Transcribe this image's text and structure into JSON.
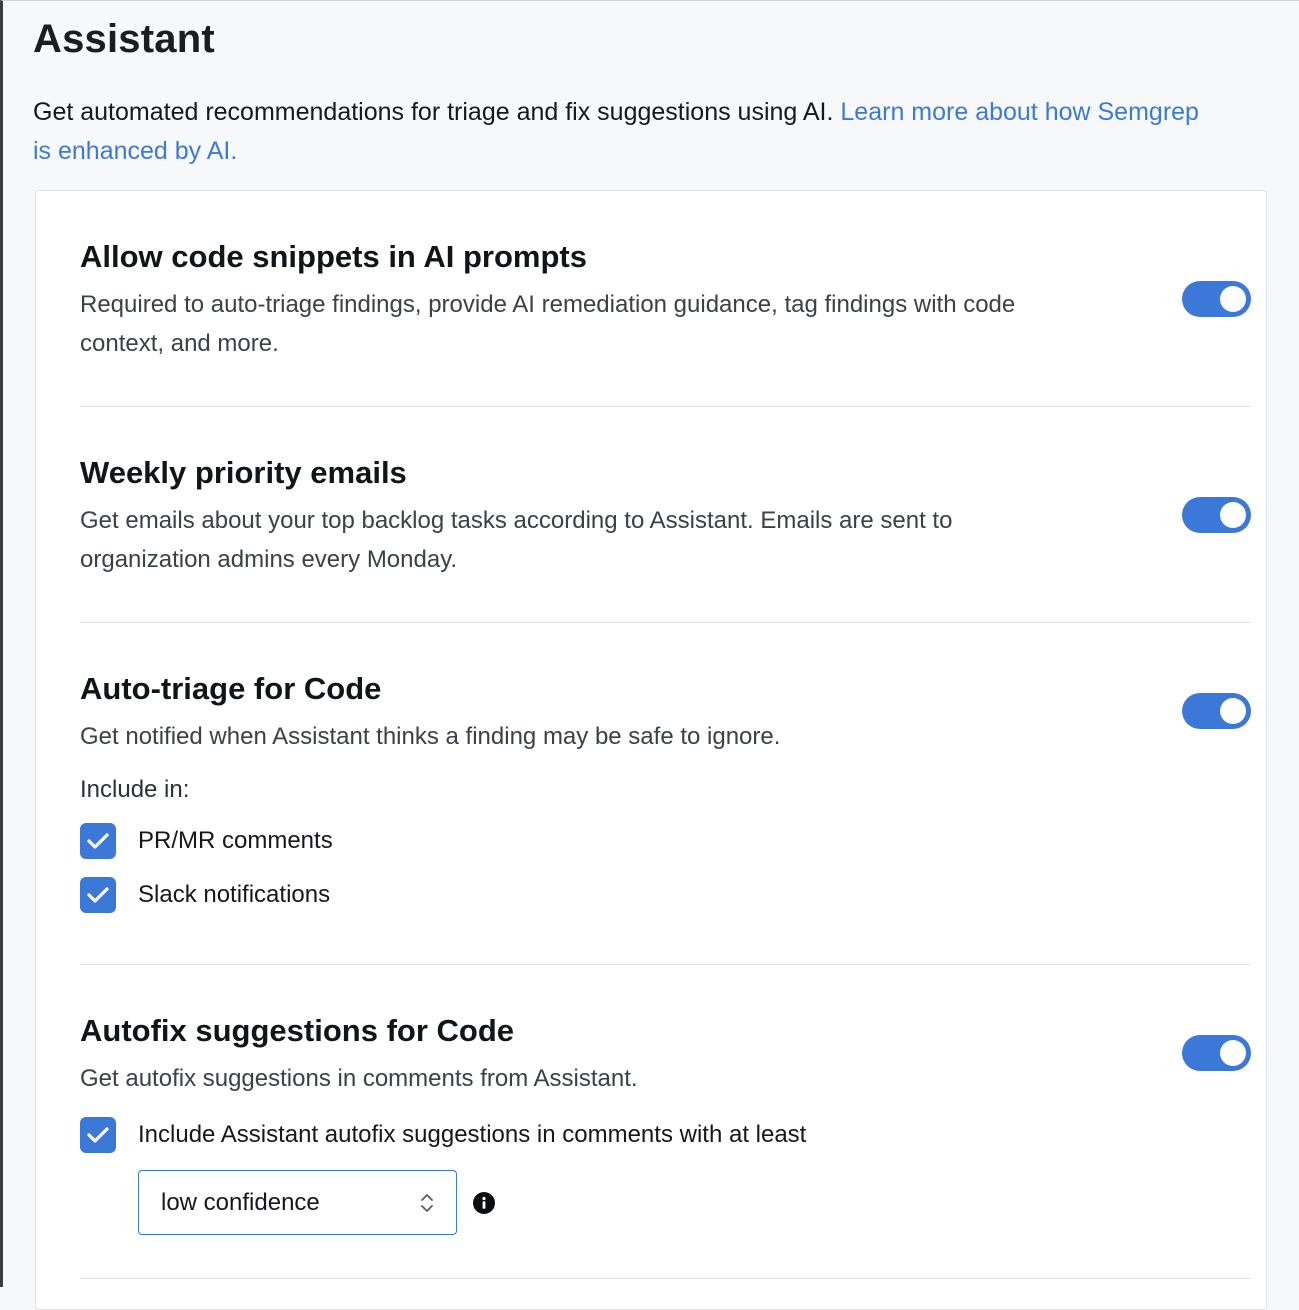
{
  "header": {
    "title": "Assistant",
    "intro_text": "Get automated recommendations for triage and fix suggestions using AI.",
    "intro_link": "Learn more about how Semgrep is enhanced by AI."
  },
  "sections": [
    {
      "title": "Allow code snippets in AI prompts",
      "description": "Required to auto-triage findings, provide AI remediation guidance, tag findings with code context, and more.",
      "enabled": true
    },
    {
      "title": "Weekly priority emails",
      "description": "Get emails about your top backlog tasks according to Assistant. Emails are sent to organization admins every Monday.",
      "enabled": true
    },
    {
      "title": "Auto-triage for Code",
      "description": "Get notified when Assistant thinks a finding may be safe to ignore.",
      "enabled": true,
      "include_label": "Include in:",
      "options": [
        {
          "label": "PR/MR comments",
          "checked": true
        },
        {
          "label": "Slack notifications",
          "checked": true
        }
      ]
    },
    {
      "title": "Autofix suggestions for Code",
      "description": "Get autofix suggestions in comments from Assistant.",
      "enabled": true,
      "option": {
        "label": "Include Assistant autofix suggestions in comments with at least",
        "checked": true
      },
      "confidence_select": {
        "value": "low confidence"
      }
    }
  ],
  "colors": {
    "accent": "#3b78d8",
    "link": "#3c7ad6"
  }
}
